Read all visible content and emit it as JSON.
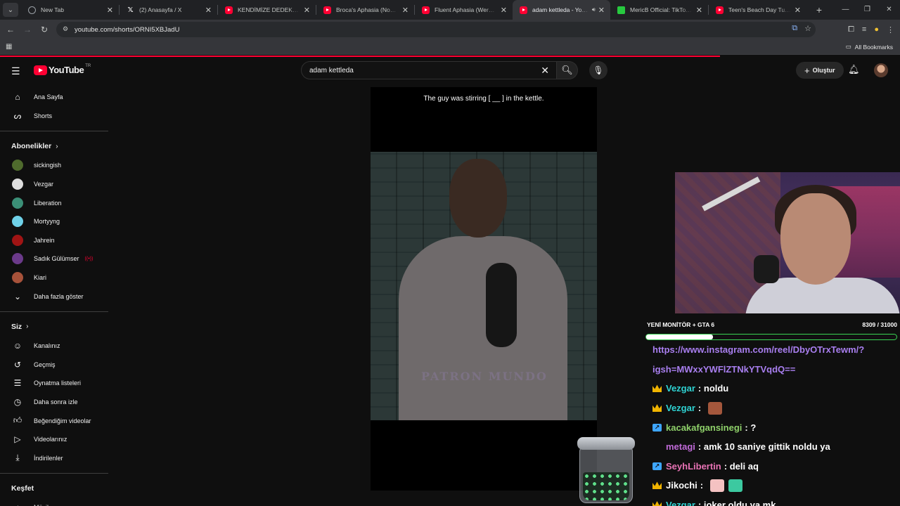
{
  "browser": {
    "tabs": [
      {
        "title": "New Tab",
        "icon": "globe",
        "active": false
      },
      {
        "title": "(2) Anasayfa / X",
        "icon": "x",
        "active": false
      },
      {
        "title": "KENDİMİZE DEDEKTİF TUTTUK",
        "icon": "yt",
        "active": false
      },
      {
        "title": "Broca's Aphasia (Non-Fluent Aphasia)",
        "icon": "yt",
        "active": false
      },
      {
        "title": "Fluent Aphasia (Wernicke's)",
        "icon": "yt",
        "active": false
      },
      {
        "title": "adam kettleda - YouTube",
        "icon": "yt",
        "active": true
      },
      {
        "title": "MericB Official: TikTok, Instagram",
        "icon": "mk",
        "active": false
      },
      {
        "title": "Teen's Beach Day Turns Into",
        "icon": "yt",
        "active": false
      }
    ],
    "url": "youtube.com/shorts/ORNI5XBJadU",
    "all_bookmarks": "All Bookmarks"
  },
  "youtube": {
    "logo_text": "YouTube",
    "country_code": "TR",
    "search_value": "adam kettleda",
    "create_label": "Oluştur"
  },
  "sidebar": {
    "main": [
      {
        "label": "Ana Sayfa",
        "icon": "home-icon"
      },
      {
        "label": "Shorts",
        "icon": "shorts-icon"
      }
    ],
    "subscriptions_title": "Abonelikler",
    "subscriptions": [
      {
        "label": "sickingish",
        "color": "#4f6b2d"
      },
      {
        "label": "Vezgar",
        "color": "#ddd"
      },
      {
        "label": "Liberation",
        "color": "#3b8f77"
      },
      {
        "label": "Mortyyng",
        "color": "#6fd1e8"
      },
      {
        "label": "Jahrein",
        "color": "#a01414"
      },
      {
        "label": "Sadık Gülümser",
        "color": "#6b3a8a",
        "live": true
      },
      {
        "label": "Kiari",
        "color": "#a7523a"
      }
    ],
    "show_more": "Daha fazla göster",
    "you_title": "Siz",
    "you_items": [
      {
        "label": "Kanalınız",
        "icon": "channel-icon"
      },
      {
        "label": "Geçmiş",
        "icon": "history-icon"
      },
      {
        "label": "Oynatma listeleri",
        "icon": "playlists-icon"
      },
      {
        "label": "Daha sonra izle",
        "icon": "watch-later-icon"
      },
      {
        "label": "Beğendiğim videolar",
        "icon": "liked-icon"
      },
      {
        "label": "Videolarınız",
        "icon": "your-videos-icon"
      },
      {
        "label": "İndirilenler",
        "icon": "downloads-icon"
      }
    ],
    "explore_title": "Keşfet",
    "explore_items": [
      {
        "label": "Müzik",
        "icon": "music-icon"
      }
    ]
  },
  "video": {
    "caption": "The guy was stirring [ __ ] in the kettle.",
    "watermark": "PATRON MUNDO"
  },
  "stream_overlay": {
    "goal_label": "YENİ MONİTÖR + GTA 6",
    "goal_count": "8309 / 31000",
    "goal_progress": 0.268,
    "chat": [
      {
        "type": "url",
        "text": "https://www.instagram.com/reel/DbyOTrxTewm/?"
      },
      {
        "type": "url",
        "text": "igsh=MWxxYWFlZTNkYTVqdQ=="
      },
      {
        "type": "msg",
        "badge": "crown",
        "user": "Vezgar",
        "color": "#2fd3d3",
        "text": "noldu"
      },
      {
        "type": "msg",
        "badge": "crown",
        "user": "Vezgar",
        "color": "#2fd3d3",
        "text": "",
        "emote": "#a4573c"
      },
      {
        "type": "msg",
        "badge": "boost",
        "user": "kacakafgansinegi",
        "color": "#8fd16a",
        "text": "?"
      },
      {
        "type": "msg",
        "badge": "",
        "user": "metagi",
        "color": "#c06ad8",
        "text": "amk 10 saniye gittik noldu ya"
      },
      {
        "type": "msg",
        "badge": "boost",
        "user": "SeyhLibertin",
        "color": "#e873b5",
        "text": "deli aq"
      },
      {
        "type": "msg",
        "badge": "crown",
        "user": "Jikochi",
        "color": "#fff",
        "text": "",
        "emote": "#f4c2c2",
        "emote2": "#3cc9a0"
      },
      {
        "type": "msg",
        "badge": "crown",
        "user": "Vezgar",
        "color": "#2fd3d3",
        "text": "joker oldu ya mk"
      }
    ]
  }
}
